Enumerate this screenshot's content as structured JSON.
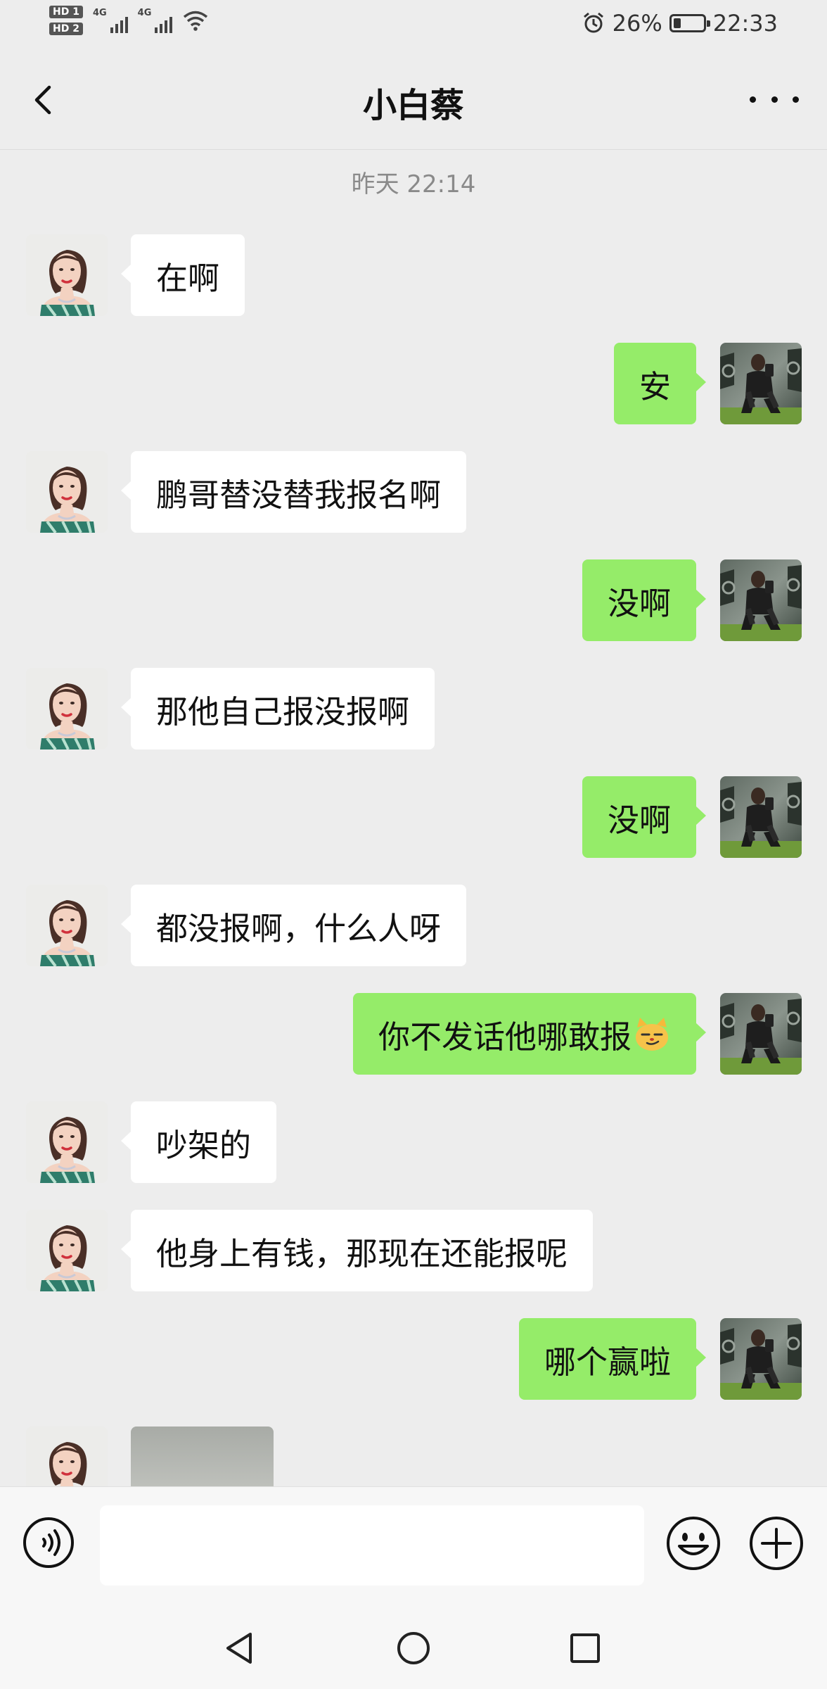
{
  "status_bar": {
    "hd1": "HD 1",
    "hd2": "HD 2",
    "net1": "4G",
    "net2": "4G",
    "battery_percent": "26%",
    "battery_level": 0.26,
    "time": "22:33"
  },
  "header": {
    "title": "小白蔡"
  },
  "chat": {
    "timestamp": "昨天 22:14",
    "messages": [
      {
        "side": "left",
        "text": "在啊"
      },
      {
        "side": "right",
        "text": "安"
      },
      {
        "side": "left",
        "text": "鹏哥替没替我报名啊"
      },
      {
        "side": "right",
        "text": "没啊"
      },
      {
        "side": "left",
        "text": "那他自己报没报啊"
      },
      {
        "side": "right",
        "text": "没啊"
      },
      {
        "side": "left",
        "text": "都没报啊，什么人呀"
      },
      {
        "side": "right",
        "text": "你不发话他哪敢报",
        "emoji": "smirking-cat-emoji"
      },
      {
        "side": "left",
        "text": "吵架的"
      },
      {
        "side": "left",
        "text": "他身上有钱，那现在还能报呢"
      },
      {
        "side": "right",
        "text": "哪个赢啦"
      }
    ]
  },
  "colors": {
    "background": "#ededed",
    "incoming_bubble": "#ffffff",
    "outgoing_bubble": "#95ec69"
  },
  "icons": {
    "back": "back-arrow-icon",
    "more": "more-dots-icon",
    "voice": "voice-icon",
    "emoji": "emoji-icon",
    "plus": "plus-icon"
  }
}
